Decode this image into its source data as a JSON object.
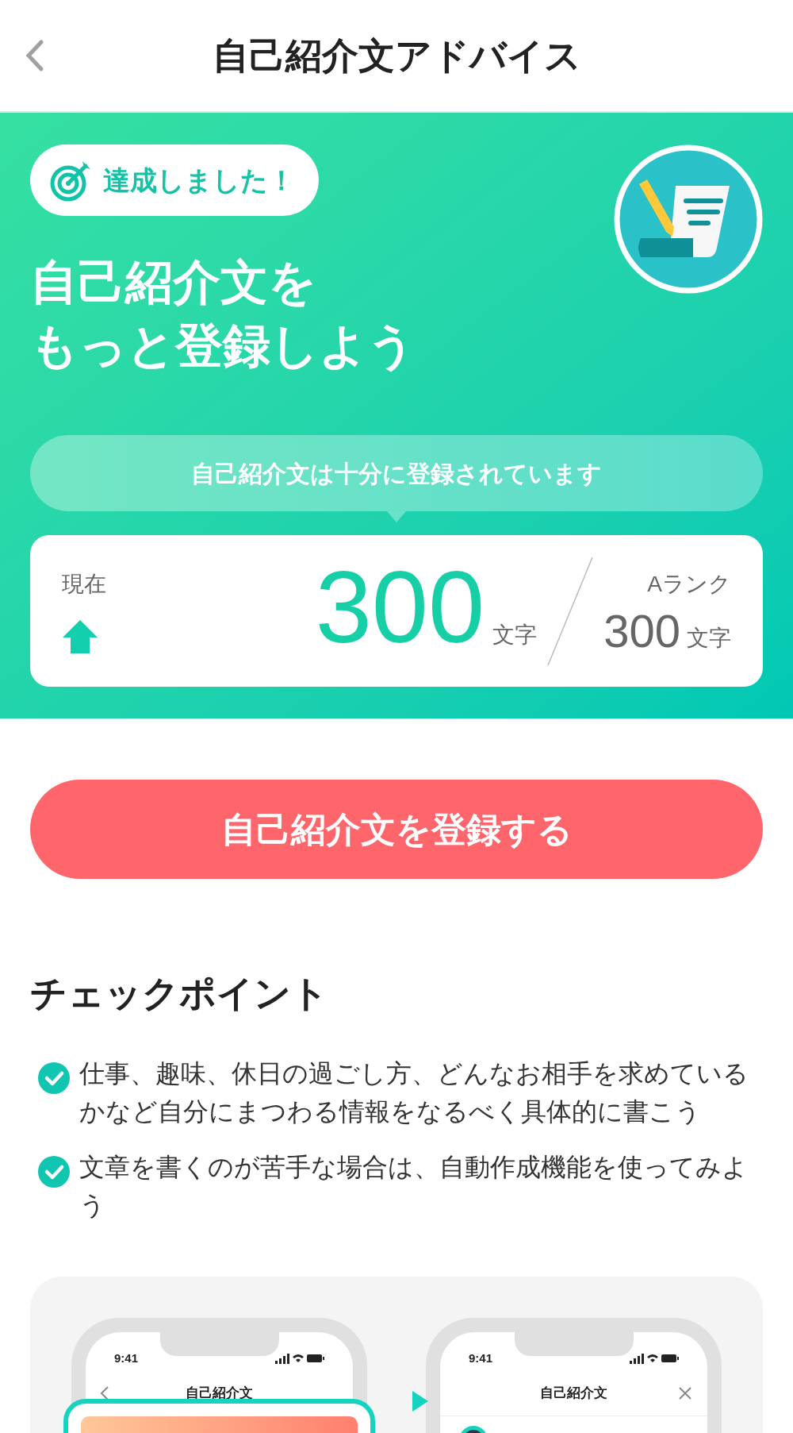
{
  "header": {
    "title": "自己紹介文アドバイス"
  },
  "hero": {
    "badge": "達成しました！",
    "heading_lines": [
      "自己紹介文を",
      "もっと登録しよう"
    ],
    "bubble": "自己紹介文は十分に登録されています",
    "card": {
      "current_label": "現在",
      "current_value": "300",
      "current_unit": "文字",
      "target_label": "Aランク",
      "target_value": "300",
      "target_unit": "文字"
    }
  },
  "register_button": "自己紹介文を登録する",
  "checkpoints": {
    "title": "チェックポイント",
    "items": [
      {
        "text": "仕事、趣味、休日の過ごし方、どんなお相手を求めているかなど自分にまつわる情報をなるべく具体的に書こう",
        "checked": true
      },
      {
        "text": "文章を書くのが苦手な場合は、自動作成機能を使ってみよう",
        "checked": true
      }
    ]
  },
  "illustration": {
    "phones": [
      {
        "time": "9:41",
        "title": "自己紹介文",
        "kind": "back",
        "highlighted": true
      },
      {
        "time": "9:41",
        "title": "自己紹介文",
        "kind": "close",
        "highlighted": false
      }
    ]
  }
}
